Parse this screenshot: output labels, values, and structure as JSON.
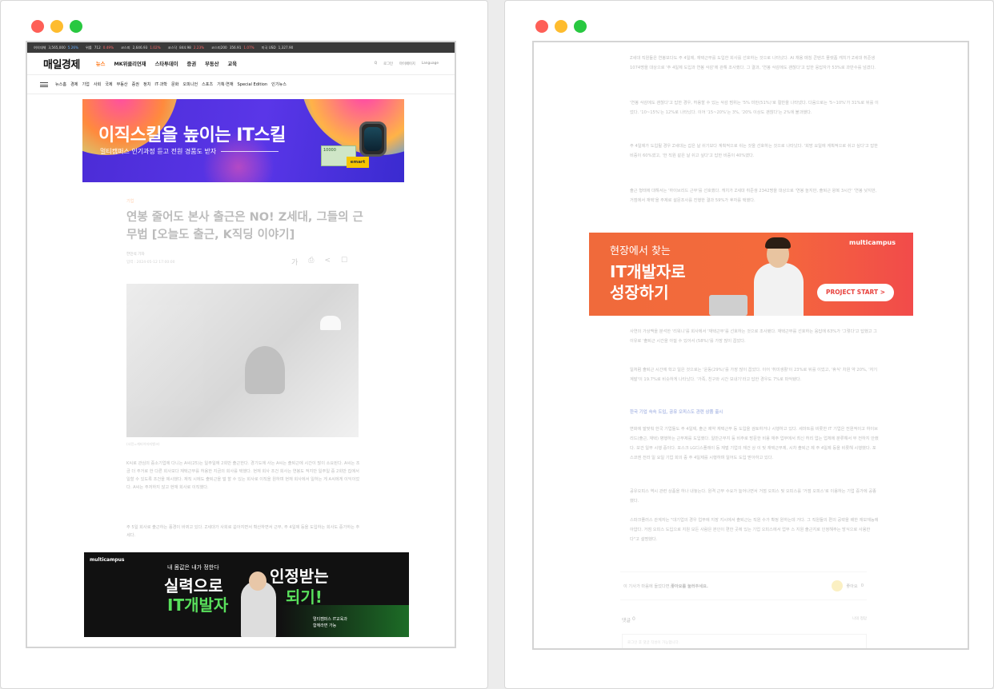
{
  "left": {
    "ticker": [
      {
        "name": "여의대체",
        "value": "3,565,000",
        "change": "5.26%",
        "dir": "down"
      },
      {
        "name": "위룰",
        "value": "712",
        "change": "0.49%",
        "dir": "up"
      },
      {
        "name": "코스피",
        "value": "2,646.93",
        "change": "1.02%",
        "dir": "up"
      },
      {
        "name": "코스닥",
        "value": "844.98",
        "change": "2.23%",
        "dir": "up"
      },
      {
        "name": "코스피200",
        "value": "356.91",
        "change": "1.07%",
        "dir": "up"
      },
      {
        "name": "미국 USD",
        "value": "1,327.90",
        "change": "",
        "dir": "down"
      }
    ],
    "logo": "매일경제",
    "topnav": [
      "뉴스",
      "MK위클리연재",
      "스타투데이",
      "증권",
      "부동산",
      "교육"
    ],
    "header_tools": [
      "Q",
      "로그인",
      "마이페이지",
      "Language"
    ],
    "subnav": [
      "뉴스홈",
      "경제",
      "기업",
      "사회",
      "국제",
      "부동산",
      "증권",
      "정치",
      "IT·과학",
      "문화",
      "오피니언",
      "스포츠",
      "기획·연재",
      "Special Edition",
      "인기뉴스"
    ],
    "banner1": {
      "title": "이직스킬을 높이는 IT스킬",
      "subtitle": "멀티캠퍼스 인기과정 듣고 전원 경품도 받자",
      "voucher": "10000",
      "brand": "emart"
    },
    "article": {
      "kicker": "기업",
      "title": "연봉 줄어도 본사 출근은 NO! Z세대, 그들의 근무법 [오늘도 출근, K직딩 이야기]",
      "byline": "한민석 기자",
      "date": "입력 : 2024-05-12 17:00:00",
      "tools": [
        "가",
        "⎙",
        "<",
        "☐"
      ],
      "caption": "(사진=게티이미지뱅크)",
      "paragraphs": [
        "K씨로 관심의 중소기업에 다니는 A씨(25)는 일주일에 2회만 출근한다. 경기도에 사는 A씨는 출퇴근에 시간이 많이 소요된다. A씨는 조금 더 주거로 한 다른 회사보다 재택근무를 허용한 지금의 회사를 택했다. 현재 회사 조건 회사는 연봉도 적지만 일주일 중 2회만 집에서 일할 수 있도록 조건을 제시했다. 재직 시에도 출퇴근을 덜 할 수 있는 회사로 이직을 원하며 현재 회사에서 일하는 게 A씨에게 이익이었다. A씨는 주저하지 않고 현재 회사로 이직했다.",
        "주 5일 회사로 출근하는 풍경이 바뀌고 있다. Z세대가 사회로 쏟아지면서 확산하면서 근무, 주 4일제 등을 도입하는 회사도 증가하는 추세다."
      ]
    },
    "banner2": {
      "brand": "multicampus",
      "small": "내 몸값은 내가 정한다",
      "line1": "실력으로",
      "line2": "인정받는",
      "line3": "IT개발자",
      "line4": "되기!",
      "note1": "멀티캠퍼스 IT교육과",
      "note2": "함께라면 가능"
    }
  },
  "right": {
    "paragraphs_top": [
      "Z세대 직원들은 연봉보다도 주 4일제, 재택근무를 도입한 회사를 선호하는 것으로 나타났다. AI 채용 매칭 콘텐츠 플랫폼 캐치가 Z세대 취준생 1074명을 대상으로 '주 4일제 도입과 연봉 삭감'에 관해 조사했다. 그 결과, '연봉 삭감에도 괜찮다'고 답한 응답자가 53%로 과반수를 넘겼다.",
      "'연봉 삭감에도 괜찮다'고 답한 경우, 허용할 수 있는 삭감 범위는 '5% 미만(51%)'로 절반을 나타냈다. 다음으로는 '5~10%'가 31%로 뒤를 이었다. '10~15%'는 12%로 나타났다. 이어 '15~20%'는 3%, '20% 이상도 괜찮다'는 2%에 불과했다.",
      "주 4일제가 도입될 경우 Z세대는 갑은 날 쉬기보다 계획적으로 쉬는 것을 선호하는 것으로 나타났다. '희망 요일에 계획적으로 쉬고 싶다'고 답한 비중이 60%였고, '한 직원 같은 날 쉬고 싶다'고 답한 비중이 40%였다.",
      "출근 형태에 대해서는 '하이브리드 근무'를 선호했다. 캐치가 Z세대 취준생 2342명을 대상으로 '연봉 높지만, 출퇴근 왕복 3시간' '연봉 낮지만, 거점에서 재택'을 주제로 설문조사를 진행한 결과 59%가 후자를 택했다."
    ],
    "banner3": {
      "line1": "현장에서 찾는",
      "line2": "IT개발자로",
      "line3": "성장하기",
      "brand": "multicampus",
      "button": "PROJECT START >"
    },
    "paragraphs_mid": [
      "사연의 가상맥을 분석한 '리워니'를 회사에서 '재택근무'를 선호하는 것으로 조사됐다. 재택근무를 선호하는 응답에 63%가 '그렇다'고 답했고 그 이유로 '출퇴근 시간을 아낄 수 있어서 (58%)'를 가장 많이 꼽았다.",
      "일처럼 출퇴근 시간에 학고 일은 것으로는 '운동(29%)'를 가장 많이 꼽았다. 이어 '취미생활'이 23%로 뒤를 이었고, '휴식' 차원 약 20%, '자기 계발'이 19.7%로 비슷하게 나타났다. '가족, 친구와 시간 보내기'라고 답한 경우도 7%로 파악됐다."
    ],
    "heading": "한국 기업 속속 도입, 공유 오피스도 관련 상품 출시",
    "paragraphs_bottom": [
      "변화에 발맞춰 한국 기업들도 주 4일제, 출근 제약 재택근무 등 도입을 검토하거나 시행하고 있다. 세마트를 비롯한 IT 기업은 전원적이고 하이브리드(출근, 재택) 병행하는 근무제를 도입했다. 일반근무지 등 비주로 방문한 비용 재주 업무에서 최신 허리 업는 업체에 분류해서 부 전하지 안했다. 보건 일부 시행 중이다. 포스크 LG디스플레이 등 재벌 기업의 재건 상 이 및 재택근무제, 시차 출퇴근 제 주 4일제 등을 비롯해 시행했다. 포스코엔 전라 일 요일 기업 회의 중 주 4일제를 시행하며 일어도 도입 받아하고 있다.",
      "공유오피스 역시 관련 상품을 하나 내놓는다. 원격 근무 수요가 늘어나면서 거점 오피스 및 오피스를 '거점 오피스'로 이용하는 기업 증가에 공종했다.",
      "스파크플러스 관계자는 \"대기업의 경우 업무에 지장 지시에서 출퇴근는 직원 수가 확정 원하는데 거다. 그 직원들의 편의 공략을 배한 재보재능에 아얍다. 거점 오피스 도입으로 지원 모든 사람은 본인이 편한 곳에 있는 기업 오피스에서 업무 스 지원 출근지로 인정해주는 방식으로 사용한다\"고 설명했다."
    ],
    "like": {
      "text": "이 기사가 마음에 들었다면, ",
      "bold": "좋아요를 눌러주세요.",
      "count_label": "좋아요",
      "count": "0"
    },
    "comments": {
      "label": "댓글",
      "count": "0",
      "sort": "나의 정답",
      "placeholder": "로그인 후 댓글 작성이 가능합니다."
    }
  }
}
